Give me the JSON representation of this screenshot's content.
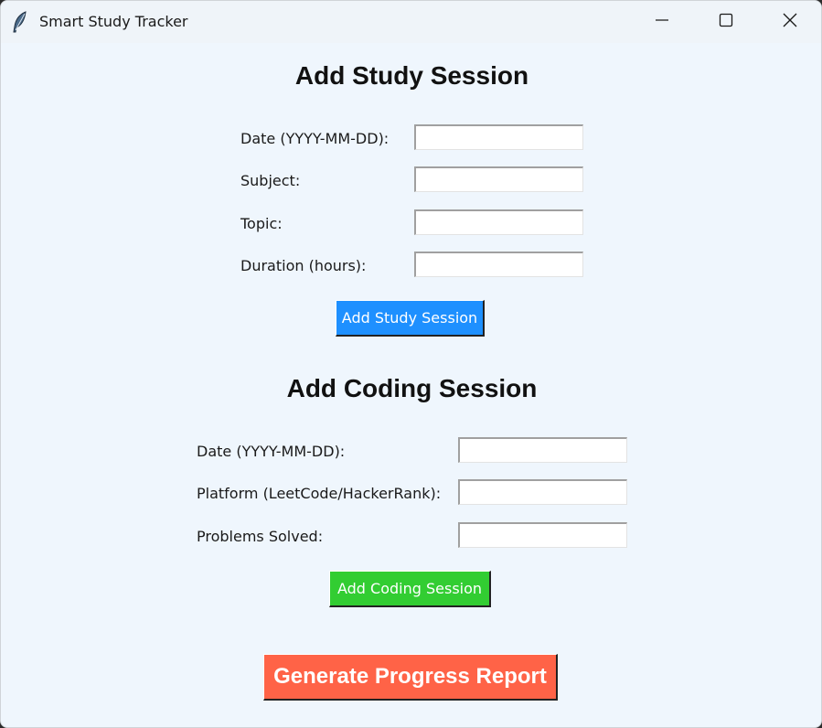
{
  "window": {
    "title": "Smart Study Tracker",
    "app_icon": "feather-icon",
    "controls": [
      "minimize-icon",
      "maximize-icon",
      "close-icon"
    ]
  },
  "study": {
    "heading": "Add Study Session",
    "fields": [
      {
        "label": "Date (YYYY-MM-DD):",
        "value": ""
      },
      {
        "label": "Subject:",
        "value": ""
      },
      {
        "label": "Topic:",
        "value": ""
      },
      {
        "label": "Duration (hours):",
        "value": ""
      }
    ],
    "button_label": "Add Study Session",
    "button_color": "#1e90ff"
  },
  "coding": {
    "heading": "Add Coding Session",
    "fields": [
      {
        "label": "Date (YYYY-MM-DD):",
        "value": ""
      },
      {
        "label": "Platform (LeetCode/HackerRank):",
        "value": ""
      },
      {
        "label": "Problems Solved:",
        "value": ""
      }
    ],
    "button_label": "Add Coding Session",
    "button_color": "#32cd32"
  },
  "report": {
    "button_label": "Generate Progress Report",
    "button_color": "#ff6347"
  },
  "colors": {
    "background": "#eff6fd"
  }
}
